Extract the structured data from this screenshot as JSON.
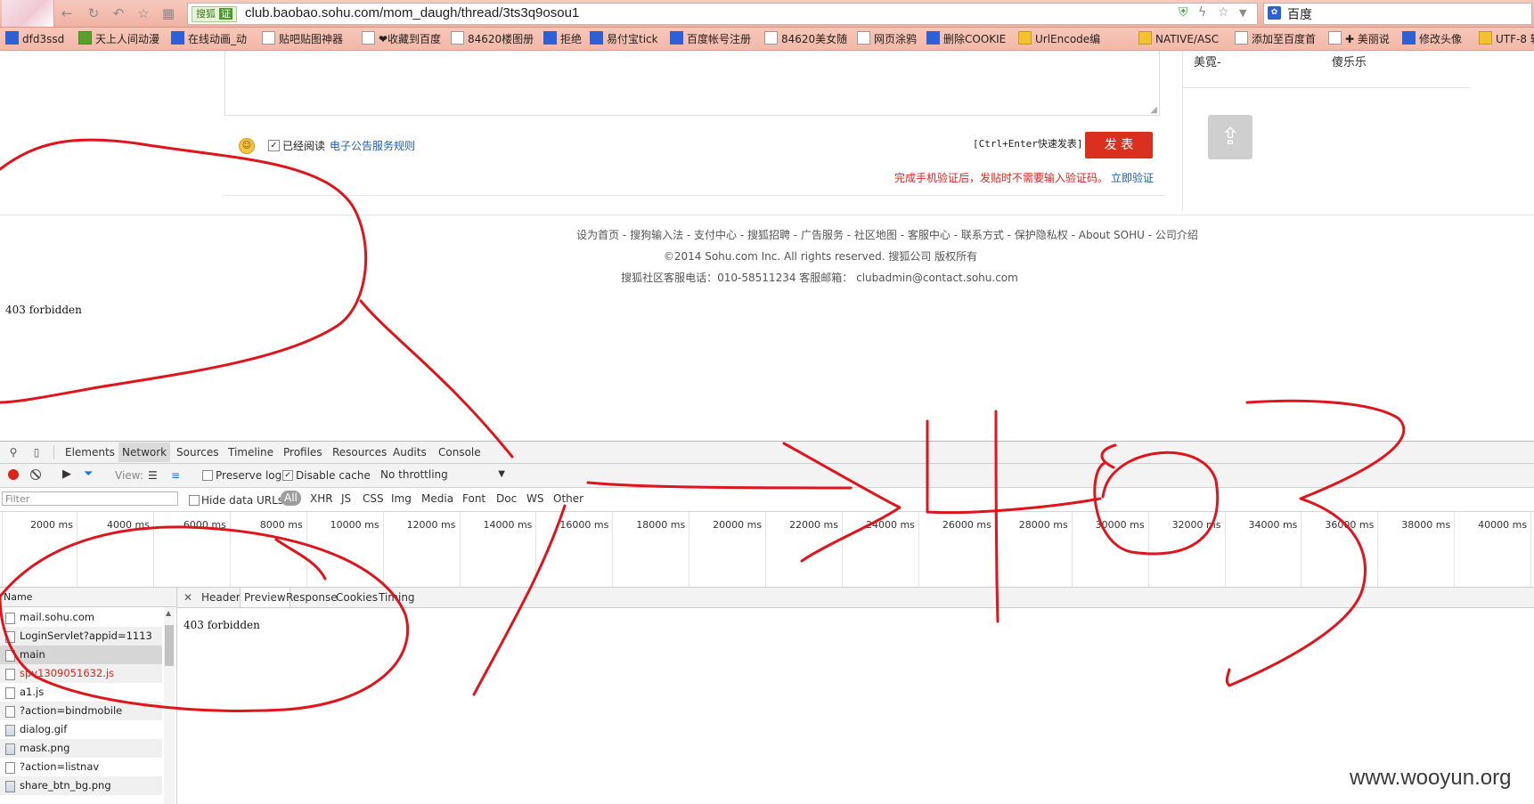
{
  "browser": {
    "address": {
      "badge": "搜狐",
      "badge_check": "证",
      "url": "club.baobao.sohu.com/mom_daugh/thread/3ts3q9osou1"
    },
    "search": {
      "engine_icon": "baidu-paw-icon",
      "engine_name": "百度"
    },
    "bookmarks": [
      {
        "label": "dfd3ssd",
        "icon": "blue"
      },
      {
        "label": "天上人间动漫",
        "icon": "green"
      },
      {
        "label": "在线动画_动",
        "icon": "blue"
      },
      {
        "label": "贴吧贴图神器",
        "icon": "page"
      },
      {
        "label": "❤收藏到百度",
        "icon": "page"
      },
      {
        "label": "84620楼图册",
        "icon": "page"
      },
      {
        "label": "拒绝",
        "icon": "blue"
      },
      {
        "label": "易付宝tick",
        "icon": "blue"
      },
      {
        "label": "百度帐号注册",
        "icon": "blue"
      },
      {
        "label": "84620美女随",
        "icon": "page"
      },
      {
        "label": "网页涂鸦",
        "icon": "page"
      },
      {
        "label": "删除COOKIE",
        "icon": "blue"
      },
      {
        "label": "UrlEncode编",
        "icon": "yellow"
      },
      {
        "label": "NATIVE/ASC",
        "icon": "yellow"
      },
      {
        "label": "添加至百度首",
        "icon": "page"
      },
      {
        "label": "✚ 美丽说",
        "icon": "page"
      },
      {
        "label": "修改头像",
        "icon": "blue"
      },
      {
        "label": "UTF-8 转",
        "icon": "yellow"
      }
    ]
  },
  "page": {
    "right_col": {
      "name_a": "美霓-",
      "name_b": "傻乐乐"
    },
    "compose": {
      "agree_label": "已经阅读",
      "agree_link": "电子公告服务规则",
      "shortcut_hint": "[Ctrl+Enter快速发表]",
      "publish_label": "发 表",
      "verify_hint": "完成手机验证后，发贴时不需要输入验证码。",
      "verify_link": "立即验证"
    },
    "footer": {
      "links": "设为首页 - 搜狗输入法 - 支付中心 - 搜狐招聘 - 广告服务 - 社区地图 - 客服中心 - 联系方式 - 保护隐私权 - About SOHU - 公司介绍",
      "copyright": "©2014 Sohu.com Inc. All rights reserved. 搜狐公司 版权所有",
      "contact": "搜狐社区客服电话：010-58511234 客服邮箱： clubadmin@contact.sohu.com"
    },
    "error_text": "403 forbidden"
  },
  "devtools": {
    "tabs": [
      "Elements",
      "Network",
      "Sources",
      "Timeline",
      "Profiles",
      "Resources",
      "Audits",
      "Console"
    ],
    "active_tab": "Network",
    "toolbar": {
      "view_label": "View:",
      "preserve_log": "Preserve log",
      "disable_cache": "Disable cache",
      "throttling": "No throttling"
    },
    "filter": {
      "placeholder": "Filter",
      "hide_data_urls": "Hide data URLs",
      "types": [
        "All",
        "XHR",
        "JS",
        "CSS",
        "Img",
        "Media",
        "Font",
        "Doc",
        "WS",
        "Other"
      ]
    },
    "timeline_ticks": [
      "2000 ms",
      "4000 ms",
      "6000 ms",
      "8000 ms",
      "10000 ms",
      "12000 ms",
      "14000 ms",
      "16000 ms",
      "18000 ms",
      "20000 ms",
      "22000 ms",
      "24000 ms",
      "26000 ms",
      "28000 ms",
      "30000 ms",
      "32000 ms",
      "34000 ms",
      "36000 ms",
      "38000 ms",
      "40000 ms"
    ],
    "name_header": "Name",
    "requests": [
      {
        "name": "mail.sohu.com",
        "kind": "doc",
        "error": false
      },
      {
        "name": "LoginServlet?appid=1113",
        "kind": "doc",
        "error": false
      },
      {
        "name": "main",
        "kind": "doc",
        "error": false,
        "selected": true
      },
      {
        "name": "spv1309051632.js",
        "kind": "doc",
        "error": true
      },
      {
        "name": "a1.js",
        "kind": "doc",
        "error": false
      },
      {
        "name": "?action=bindmobile",
        "kind": "doc",
        "error": false
      },
      {
        "name": "dialog.gif",
        "kind": "img",
        "error": false
      },
      {
        "name": "mask.png",
        "kind": "img",
        "error": false
      },
      {
        "name": "?action=listnav",
        "kind": "doc",
        "error": false
      },
      {
        "name": "share_btn_bg.png",
        "kind": "img",
        "error": false
      }
    ],
    "detail_tabs": [
      "Headers",
      "Preview",
      "Response",
      "Cookies",
      "Timing"
    ],
    "active_detail_tab": "Preview",
    "preview_text": "403 forbidden"
  },
  "watermark": "www.wooyun.org",
  "annotation_color": "#e0141c"
}
